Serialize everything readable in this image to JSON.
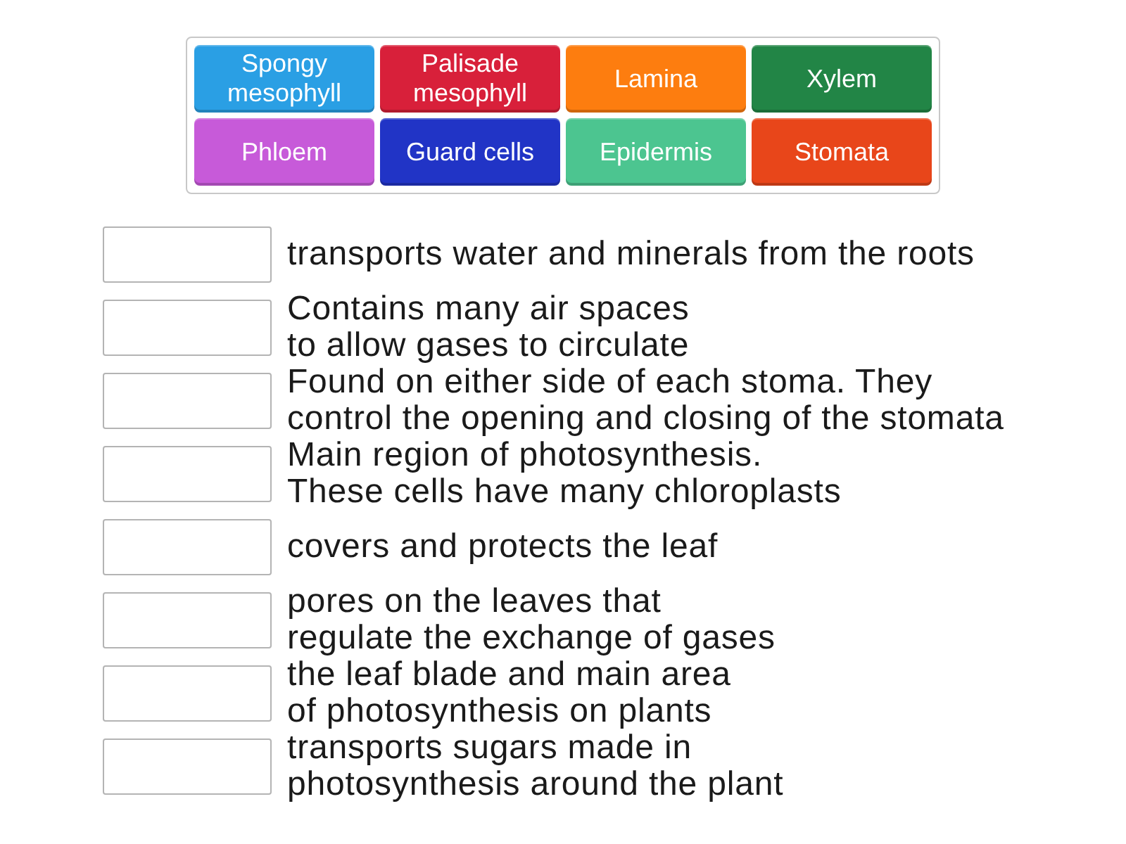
{
  "tiles": [
    {
      "label": "Spongy mesophyll",
      "color": "#2a9fe4"
    },
    {
      "label": "Palisade mesophyll",
      "color": "#d8203a"
    },
    {
      "label": "Lamina",
      "color": "#fd7d0f"
    },
    {
      "label": "Xylem",
      "color": "#228546"
    },
    {
      "label": "Phloem",
      "color": "#c75ad9"
    },
    {
      "label": "Guard cells",
      "color": "#2134c6"
    },
    {
      "label": "Epidermis",
      "color": "#4cc590"
    },
    {
      "label": "Stomata",
      "color": "#e8461a"
    }
  ],
  "rows": [
    {
      "text": "transports water and minerals from the roots"
    },
    {
      "text": "Contains many air spaces\nto allow gases to circulate"
    },
    {
      "text": "Found on either side of each stoma. They\ncontrol the opening and closing of the stomata"
    },
    {
      "text": "Main region of photosynthesis.\nThese cells have many chloroplasts"
    },
    {
      "text": "covers and protects the leaf"
    },
    {
      "text": "pores on the leaves that\nregulate the exchange of gases"
    },
    {
      "text": "the leaf blade and main area\nof photosynthesis on plants"
    },
    {
      "text": "transports sugars made in\nphotosynthesis around the plant"
    }
  ]
}
